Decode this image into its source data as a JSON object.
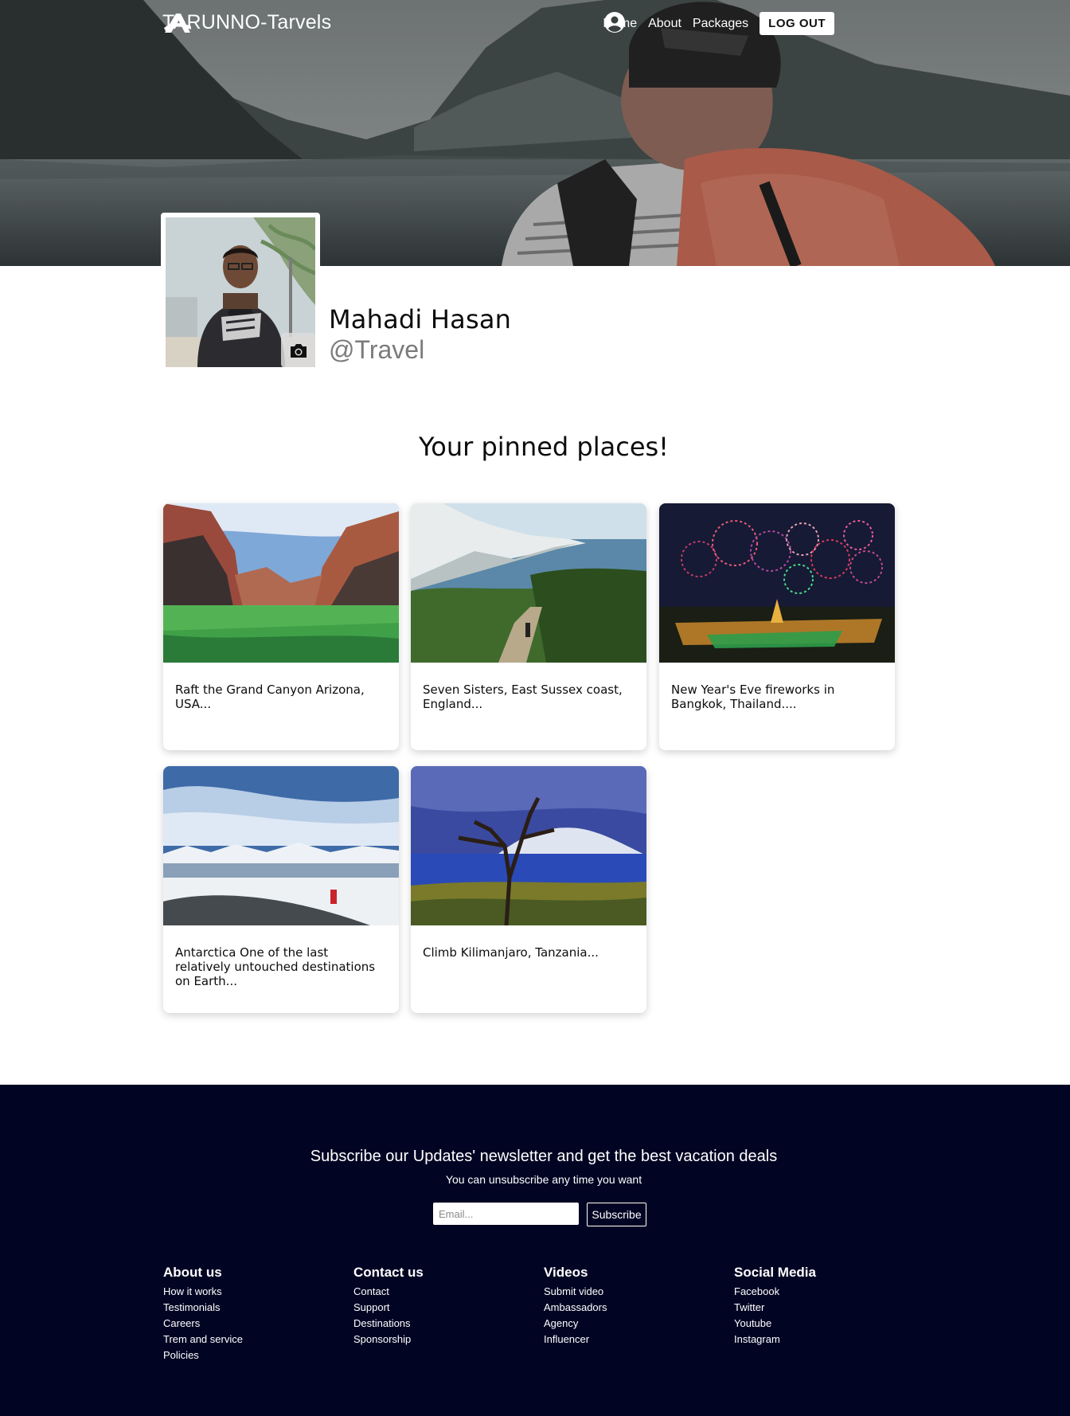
{
  "nav": {
    "brand": "TARUNNO-Tarvels",
    "links": [
      "Home",
      "About",
      "Packages"
    ],
    "logout": "LOG OUT"
  },
  "profile": {
    "name": "Mahadi Hasan",
    "handle": "@Travel"
  },
  "pinned": {
    "title": "Your pinned places!",
    "cards": [
      {
        "text": "Raft the Grand Canyon Arizona, USA..."
      },
      {
        "text": "Seven Sisters, East Sussex coast, England..."
      },
      {
        "text": "New Year's Eve fireworks in Bangkok, Thailand...."
      },
      {
        "text": "Antarctica One of the last relatively untouched destinations on Earth..."
      },
      {
        "text": "Climb Kilimanjaro, Tanzania..."
      }
    ]
  },
  "footer": {
    "newsletter_title": "Subscribe our Updates' newsletter and get the best vacation deals",
    "newsletter_sub": "You can unsubscribe any time you want",
    "email_placeholder": "Email...",
    "subscribe": "Subscribe",
    "columns": [
      {
        "title": "About us",
        "links": [
          "How it works",
          "Testimonials",
          "Careers",
          "Trem and service",
          "Policies"
        ]
      },
      {
        "title": "Contact us",
        "links": [
          "Contact",
          "Support",
          "Destinations",
          "Sponsorship"
        ]
      },
      {
        "title": "Videos",
        "links": [
          "Submit video",
          "Ambassadors",
          "Agency",
          "Influencer"
        ]
      },
      {
        "title": "Social Media",
        "links": [
          "Facebook",
          "Twitter",
          "Youtube",
          "Instagram"
        ]
      }
    ]
  }
}
